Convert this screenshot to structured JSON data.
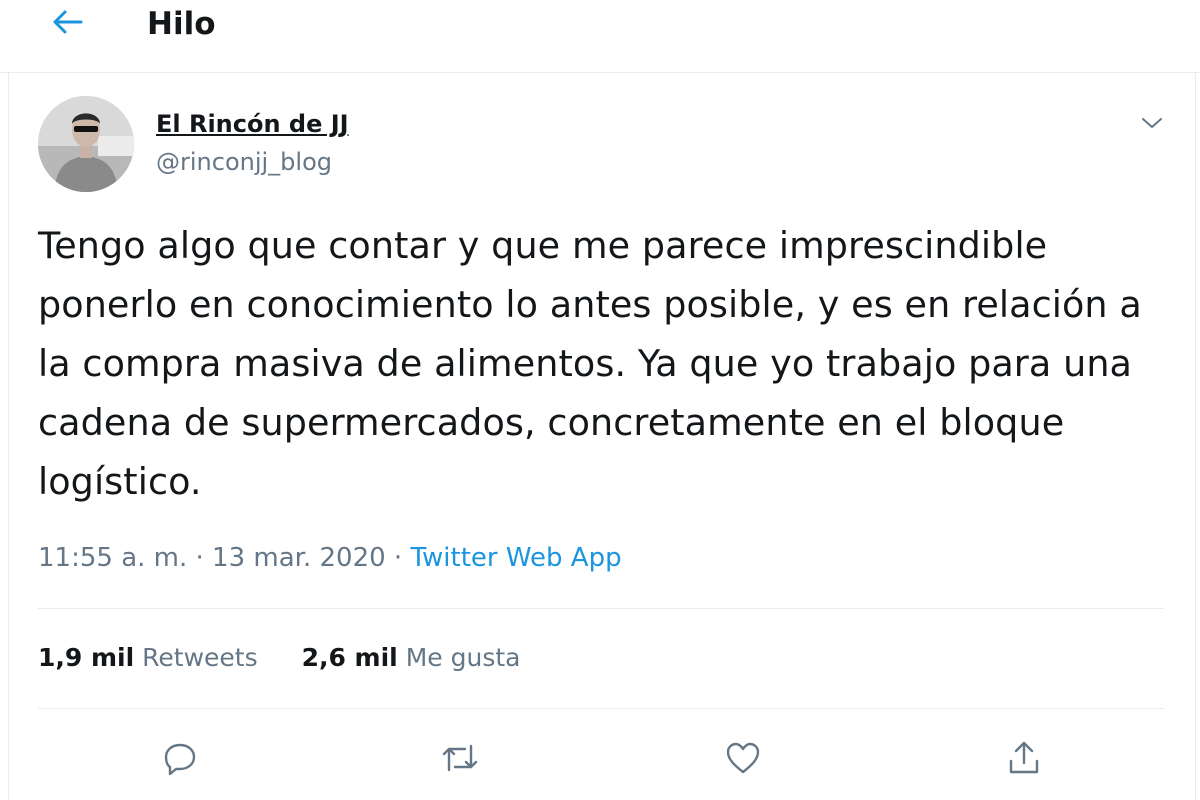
{
  "header": {
    "title": "Hilo",
    "back_icon": "arrow-left-icon"
  },
  "tweet": {
    "author": {
      "display_name": "El Rincón de JJ",
      "handle": "@rinconjj_blog"
    },
    "text": "Tengo algo que contar y que me parece imprescindible ponerlo en conocimiento lo antes posible, y es en relación a la compra masiva de alimentos. Ya que yo trabajo para una cadena de supermercados, concretamente en el bloque logístico.",
    "time": "11:55 a. m.",
    "date": "13 mar. 2020",
    "separator": "·",
    "source": "Twitter Web App",
    "stats": {
      "retweets_count": "1,9 mil",
      "retweets_label": "Retweets",
      "likes_count": "2,6 mil",
      "likes_label": "Me gusta"
    }
  },
  "actions": [
    {
      "name": "reply",
      "icon": "reply-icon"
    },
    {
      "name": "retweet",
      "icon": "retweet-icon"
    },
    {
      "name": "like",
      "icon": "heart-icon"
    },
    {
      "name": "share",
      "icon": "share-icon"
    }
  ],
  "colors": {
    "accent": "#1b95e0",
    "secondary_text": "#657786",
    "border": "#e6ecf0"
  }
}
